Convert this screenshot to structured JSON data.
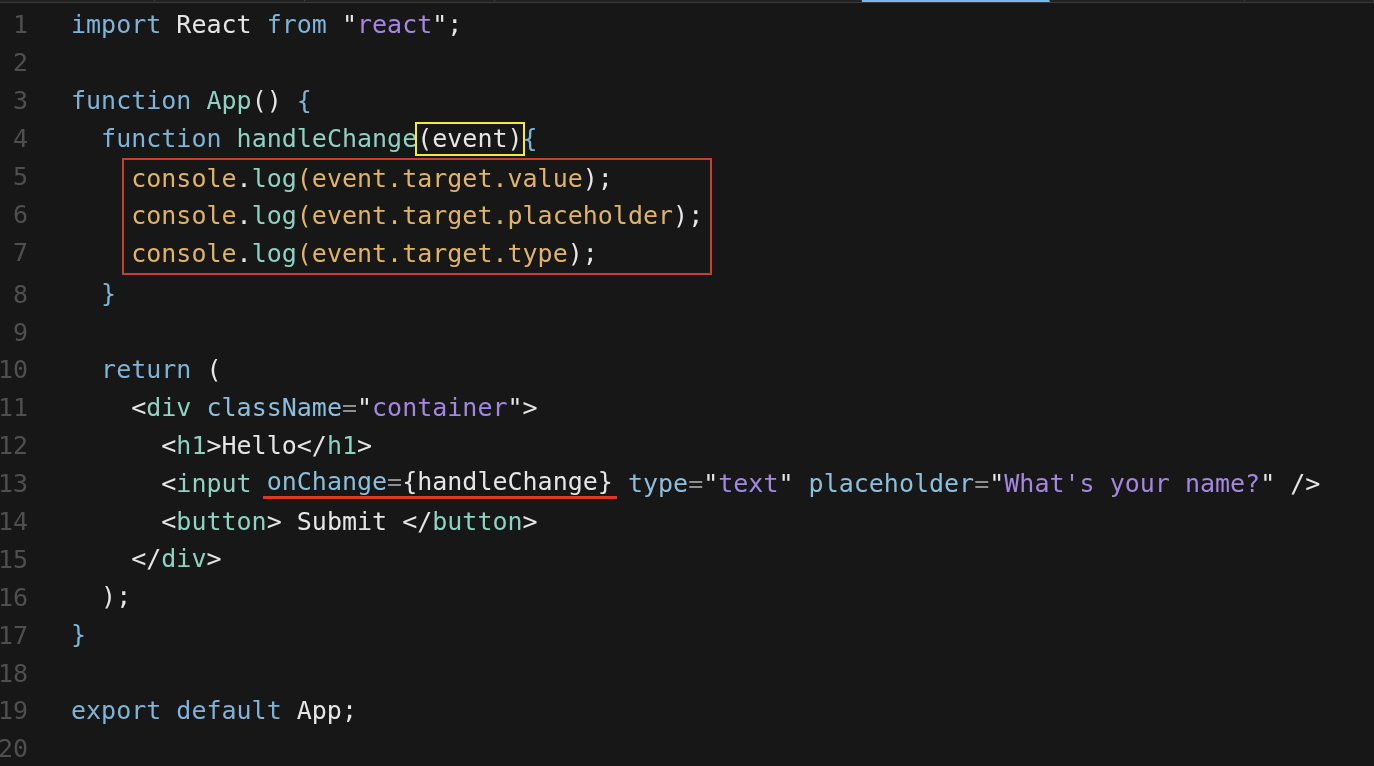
{
  "tabs": [
    {
      "selected": false
    },
    {
      "selected": false
    },
    {
      "selected": false
    },
    {
      "selected": false
    },
    {
      "selected": true
    },
    {
      "selected": false
    },
    {
      "selected": false
    }
  ],
  "lines": [
    {
      "number": "1",
      "boxed": false,
      "tokens": [
        {
          "kind": "kw",
          "text": "import"
        },
        {
          "kind": "tx",
          "text": " React "
        },
        {
          "kind": "kw",
          "text": "from"
        },
        {
          "kind": "tx",
          "text": " \""
        },
        {
          "kind": "str",
          "text": "react"
        },
        {
          "kind": "tx",
          "text": "\";"
        }
      ]
    },
    {
      "number": "2",
      "boxed": false
    },
    {
      "number": "3",
      "boxed": false,
      "tokens": [
        {
          "kind": "kw",
          "text": "function "
        },
        {
          "kind": "fn",
          "text": "App"
        },
        {
          "kind": "tx",
          "text": "() "
        },
        {
          "kind": "kw",
          "text": "{"
        }
      ]
    },
    {
      "number": "4",
      "boxed": false,
      "tokens": [
        {
          "kind": "kw",
          "text": "  function "
        },
        {
          "kind": "fn",
          "text": "handleChange"
        },
        {
          "kind": "tx",
          "text": "(event)",
          "boxed": true
        },
        {
          "kind": "kw",
          "text": "{"
        }
      ]
    },
    {
      "number": "5",
      "boxed": true,
      "tokens": [
        {
          "kind": "pr",
          "text": "    console"
        },
        {
          "kind": "tx",
          "text": "."
        },
        {
          "kind": "fn",
          "text": "log"
        },
        {
          "kind": "pr",
          "text": "(event.target.value"
        },
        {
          "kind": "tx",
          "text": ");"
        }
      ]
    },
    {
      "number": "6",
      "boxed": true,
      "tokens": [
        {
          "kind": "pr",
          "text": "    console"
        },
        {
          "kind": "tx",
          "text": "."
        },
        {
          "kind": "fn",
          "text": "log"
        },
        {
          "kind": "pr",
          "text": "(event.target.placeholder"
        },
        {
          "kind": "tx",
          "text": ");"
        }
      ]
    },
    {
      "number": "7",
      "boxed": true,
      "tokens": [
        {
          "kind": "pr",
          "text": "    console"
        },
        {
          "kind": "tx",
          "text": "."
        },
        {
          "kind": "fn",
          "text": "log"
        },
        {
          "kind": "pr",
          "text": "(event.target.type"
        },
        {
          "kind": "tx",
          "text": ");"
        }
      ]
    },
    {
      "number": "8",
      "boxed": false,
      "tokens": [
        {
          "kind": "kw",
          "text": "  }"
        }
      ]
    },
    {
      "number": "9",
      "boxed": false
    },
    {
      "number": "10",
      "boxed": false,
      "tokens": [
        {
          "kind": "kw",
          "text": "  return"
        },
        {
          "kind": "tx",
          "text": " ("
        }
      ]
    },
    {
      "number": "11",
      "boxed": false,
      "tokens": [
        {
          "kind": "tx",
          "text": "    <"
        },
        {
          "kind": "tag",
          "text": "div"
        },
        {
          "kind": "at",
          "text": " className"
        },
        {
          "kind": "op",
          "text": "="
        },
        {
          "kind": "tx",
          "text": "\""
        },
        {
          "kind": "str",
          "text": "container"
        },
        {
          "kind": "tx",
          "text": "\">"
        }
      ]
    },
    {
      "number": "12",
      "boxed": false,
      "tokens": [
        {
          "kind": "tx",
          "text": "      <"
        },
        {
          "kind": "tag",
          "text": "h1"
        },
        {
          "kind": "tx",
          "text": ">Hello</"
        },
        {
          "kind": "tag",
          "text": "h1"
        },
        {
          "kind": "tx",
          "text": ">"
        }
      ]
    },
    {
      "number": "13",
      "boxed": false,
      "tokens": [
        {
          "kind": "tx",
          "text": "      <"
        },
        {
          "kind": "tag",
          "text": "input "
        },
        {
          "kind": "at",
          "text": "onChange",
          "underlined": true
        },
        {
          "kind": "op",
          "text": "=",
          "underlined": true
        },
        {
          "kind": "tx",
          "text": "{handleChange}",
          "underlined": true
        },
        {
          "kind": "at",
          "text": " type"
        },
        {
          "kind": "op",
          "text": "="
        },
        {
          "kind": "tx",
          "text": "\""
        },
        {
          "kind": "str",
          "text": "text"
        },
        {
          "kind": "tx",
          "text": "\" "
        },
        {
          "kind": "at",
          "text": "placeholder"
        },
        {
          "kind": "op",
          "text": "="
        },
        {
          "kind": "tx",
          "text": "\""
        },
        {
          "kind": "str",
          "text": "What's your name?"
        },
        {
          "kind": "tx",
          "text": "\" />"
        }
      ]
    },
    {
      "number": "14",
      "boxed": false,
      "tokens": [
        {
          "kind": "tx",
          "text": "      <"
        },
        {
          "kind": "tag",
          "text": "button"
        },
        {
          "kind": "tx",
          "text": "> Submit </"
        },
        {
          "kind": "tag",
          "text": "button"
        },
        {
          "kind": "tx",
          "text": ">"
        }
      ]
    },
    {
      "number": "15",
      "boxed": false,
      "tokens": [
        {
          "kind": "tx",
          "text": "    </"
        },
        {
          "kind": "tag",
          "text": "div"
        },
        {
          "kind": "tx",
          "text": ">"
        }
      ]
    },
    {
      "number": "16",
      "boxed": false,
      "tokens": [
        {
          "kind": "tx",
          "text": "  );"
        }
      ]
    },
    {
      "number": "17",
      "boxed": false,
      "tokens": [
        {
          "kind": "kw",
          "text": "}"
        }
      ]
    },
    {
      "number": "18",
      "boxed": false
    },
    {
      "number": "19",
      "boxed": false,
      "tokens": [
        {
          "kind": "kw",
          "text": "export default"
        },
        {
          "kind": "tx",
          "text": " App;"
        }
      ]
    },
    {
      "number": "20",
      "boxed": false
    }
  ]
}
